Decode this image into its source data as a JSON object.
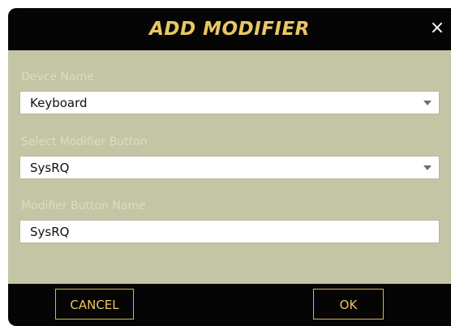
{
  "dialog": {
    "title": "ADD MODIFIER",
    "close_icon": "close-icon",
    "close_glyph": "×"
  },
  "fields": {
    "device_name": {
      "label": "Devce Name",
      "value": "Keyboard",
      "icon": "chevron-down-icon"
    },
    "modifier_button": {
      "label": "Select Modifier Button",
      "value": "SysRQ",
      "icon": "chevron-down-icon"
    },
    "modifier_name": {
      "label": "Modifier Button Name",
      "value": "SysRQ"
    }
  },
  "buttons": {
    "cancel": "CANCEL",
    "ok": "OK"
  },
  "colors": {
    "title_bar": "#050505",
    "title_text": "#e9c766",
    "body": "#c4c5a4",
    "label_text": "#dcdcc4",
    "button_border": "#d6b457"
  }
}
